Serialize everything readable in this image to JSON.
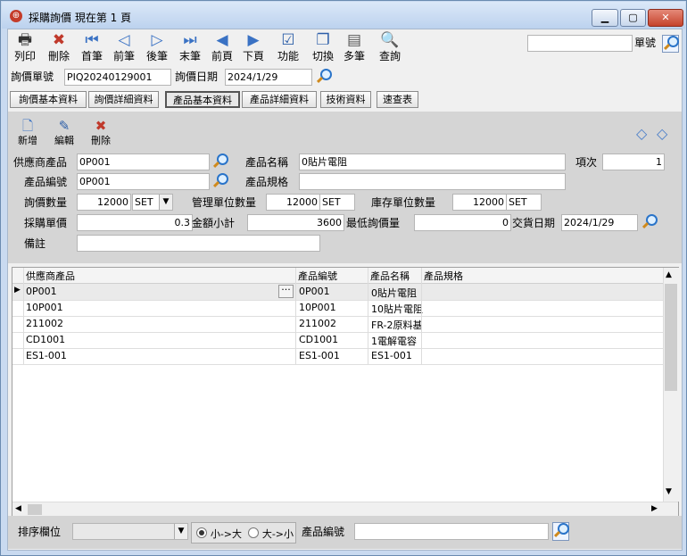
{
  "window": {
    "title": "採購詢價  現在第 1 頁"
  },
  "toolbar": [
    {
      "label": "列印",
      "icon": "printer-icon",
      "glyph": "🖶"
    },
    {
      "label": "刪除",
      "icon": "delete-icon",
      "glyph": "✖"
    },
    {
      "label": "首筆",
      "icon": "first-record-icon",
      "glyph": "⏮"
    },
    {
      "label": "前筆",
      "icon": "prev-record-icon",
      "glyph": "◁"
    },
    {
      "label": "後筆",
      "icon": "next-record-icon",
      "glyph": "▷"
    },
    {
      "label": "末筆",
      "icon": "last-record-icon",
      "glyph": "⏭"
    },
    {
      "label": "前頁",
      "icon": "prev-page-icon",
      "glyph": "◀"
    },
    {
      "label": "下頁",
      "icon": "next-page-icon",
      "glyph": "▶"
    },
    {
      "label": "功能",
      "icon": "function-icon",
      "glyph": "☑"
    },
    {
      "label": "切換",
      "icon": "switch-icon",
      "glyph": "❐"
    },
    {
      "label": "多筆",
      "icon": "multi-record-icon",
      "glyph": "▤"
    },
    {
      "label": "查詢",
      "icon": "query-icon",
      "glyph": "🔍"
    }
  ],
  "search": {
    "value": "",
    "label": "單號"
  },
  "header": {
    "inquiry_no_label": "詢價單號",
    "inquiry_no": "PIQ20240129001",
    "inquiry_date_label": "詢價日期",
    "inquiry_date": "2024/1/29"
  },
  "tabs": [
    "詢價基本資料",
    "詢價詳細資料",
    "產品基本資料",
    "產品詳細資料",
    "技術資料",
    "速查表"
  ],
  "subtoolbar": [
    {
      "label": "新增",
      "icon": "new-doc-icon",
      "glyph": "🗋"
    },
    {
      "label": "編輯",
      "icon": "edit-icon",
      "glyph": "✎"
    },
    {
      "label": "刪除",
      "icon": "delete-icon",
      "glyph": "✖"
    }
  ],
  "form": {
    "supplier_product_label": "供應商產品",
    "supplier_product": "0P001",
    "product_name_label": "產品名稱",
    "product_name": "0貼片電阻",
    "item_no_label": "項次",
    "item_no": "1",
    "product_code_label": "產品編號",
    "product_code": "0P001",
    "product_spec_label": "產品規格",
    "product_spec": "",
    "inquiry_qty_label": "詢價數量",
    "inquiry_qty": "12000",
    "inquiry_unit": "SET",
    "mgmt_qty_label": "管理單位數量",
    "mgmt_qty": "12000",
    "mgmt_unit": "SET",
    "stock_qty_label": "庫存單位數量",
    "stock_qty": "12000",
    "stock_unit": "SET",
    "unit_price_label": "採購單價",
    "unit_price": "0.3",
    "amount_label": "金額小計",
    "amount": "3600",
    "min_qty_label": "最低詢價量",
    "min_qty": "0",
    "delivery_date_label": "交貨日期",
    "delivery_date": "2024/1/29",
    "remark_label": "備註",
    "remark": ""
  },
  "grid": {
    "columns": [
      "供應商產品",
      "產品編號",
      "產品名稱",
      "產品規格"
    ],
    "rows": [
      [
        "0P001",
        "0P001",
        "0貼片電阻",
        ""
      ],
      [
        "10P001",
        "10P001",
        "10貼片電阻",
        ""
      ],
      [
        "211002",
        "211002",
        "FR-2原料基",
        ""
      ],
      [
        "CD1001",
        "CD1001",
        "1電解電容",
        ""
      ],
      [
        "ES1-001",
        "ES1-001",
        "ES1-001",
        ""
      ]
    ]
  },
  "footer": {
    "sort_label": "排序欄位",
    "sort_value": "",
    "asc_label": "小->大",
    "desc_label": "大->小",
    "asc_selected": true,
    "product_code_label": "產品編號",
    "product_code_value": ""
  }
}
